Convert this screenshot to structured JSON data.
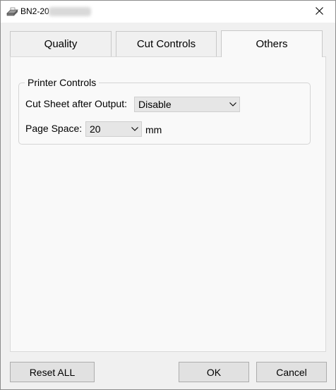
{
  "window": {
    "title": "BN2-20",
    "close_icon": "close-icon",
    "app_icon": "printer-icon"
  },
  "tabs": [
    {
      "label": "Quality",
      "active": false
    },
    {
      "label": "Cut Controls",
      "active": false
    },
    {
      "label": "Others",
      "active": true
    }
  ],
  "printer_controls": {
    "group_title": "Printer Controls",
    "cut_sheet_label": "Cut Sheet after Output:",
    "cut_sheet_value": "Disable",
    "page_space_label": "Page Space:",
    "page_space_value": "20",
    "page_space_unit": "mm"
  },
  "buttons": {
    "reset_all": "Reset ALL",
    "ok": "OK",
    "cancel": "Cancel"
  }
}
